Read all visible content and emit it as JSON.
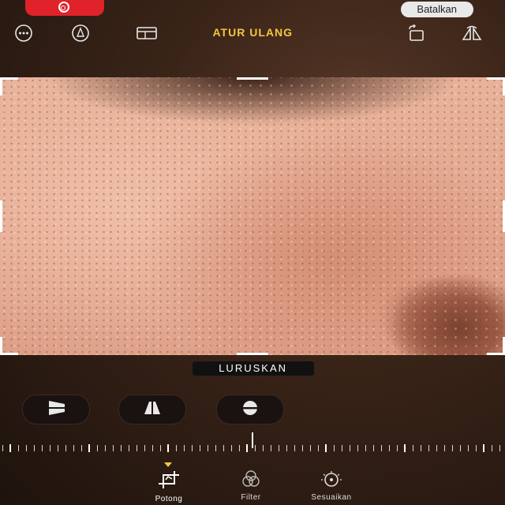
{
  "header": {
    "cancel_label": "Batalkan",
    "title": "ATUR ULANG",
    "icons": [
      "flip-icon",
      "rotate-icon",
      "aspect-ratio-icon",
      "markup-icon",
      "more-icon"
    ]
  },
  "recording": {
    "icon": "record-icon",
    "color": "#e0222a"
  },
  "straighten": {
    "label": "LURUSKAN"
  },
  "adjustments": [
    {
      "name": "straighten",
      "icon": "straighten-icon"
    },
    {
      "name": "vertical",
      "icon": "vertical-perspective-icon"
    },
    {
      "name": "horizontal",
      "icon": "horizontal-perspective-icon"
    }
  ],
  "toolbar": {
    "items": [
      {
        "label": "Sesuaikan",
        "icon": "adjust-icon"
      },
      {
        "label": "Filter",
        "icon": "filter-icon"
      },
      {
        "label": "Potong",
        "icon": "crop-icon"
      }
    ],
    "active": "Potong",
    "accent": "#f3c640"
  }
}
